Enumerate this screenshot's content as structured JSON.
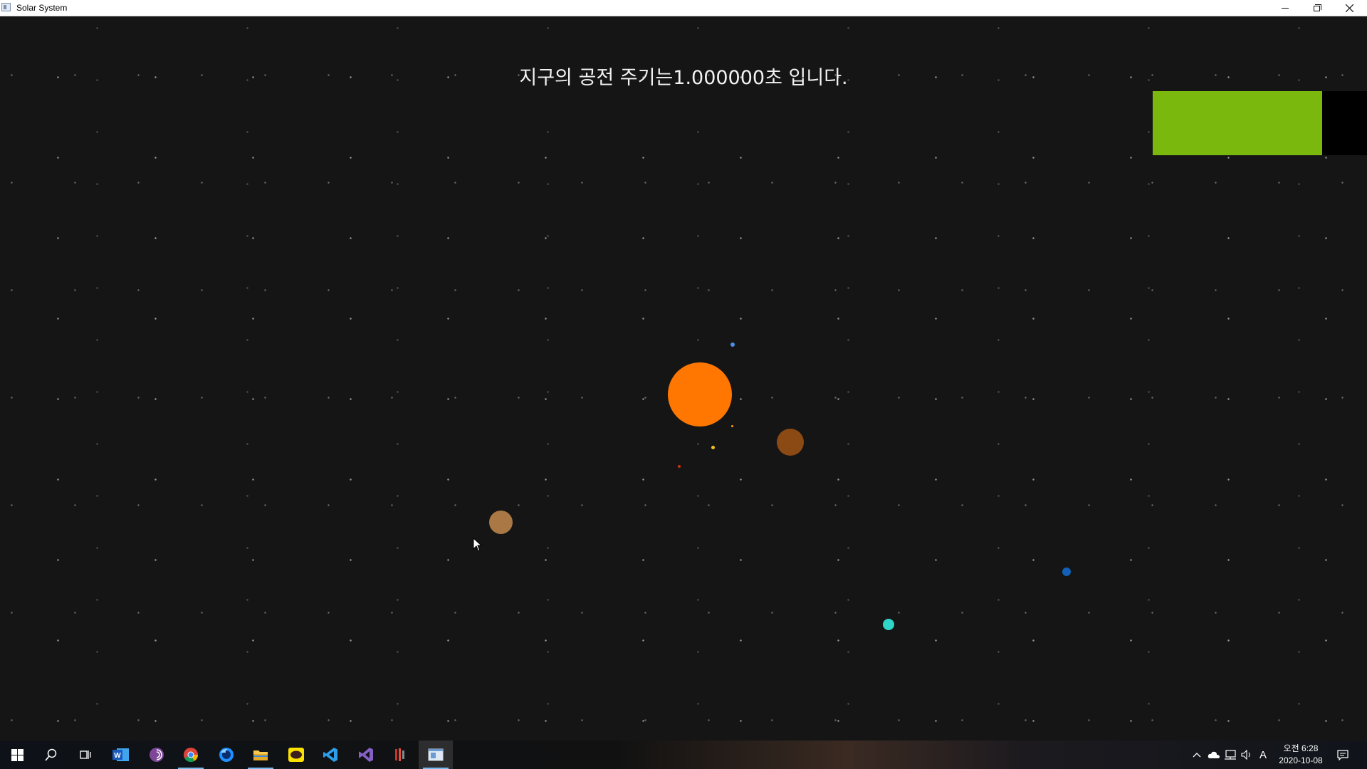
{
  "window": {
    "title": "Solar System",
    "controls": [
      "minimize-icon",
      "restore-icon",
      "close-icon"
    ]
  },
  "scene": {
    "caption": "지구의 공전 주기는1.000000초 입니다.",
    "colors": {
      "background": "#151515",
      "sun": "#ff7700",
      "green_panel": "#7ab80d",
      "black_panel": "#000000"
    },
    "bodies": [
      {
        "name": "sun",
        "color": "#ff7700"
      },
      {
        "name": "planet-brown-large",
        "color": "#8b4a14"
      },
      {
        "name": "planet-tan",
        "color": "#a97845"
      },
      {
        "name": "planet-cyan",
        "color": "#2fd6c8"
      },
      {
        "name": "planet-blue",
        "color": "#1260b8"
      },
      {
        "name": "planet-small-blue",
        "color": "#4a90e2"
      },
      {
        "name": "planet-yellow",
        "color": "#f0c020"
      },
      {
        "name": "planet-red",
        "color": "#d03010"
      },
      {
        "name": "planet-orange-tiny",
        "color": "#ff9a20"
      }
    ]
  },
  "taskbar": {
    "icons": [
      "windows-start-icon",
      "search-icon",
      "task-view-icon",
      "word-icon",
      "tor-icon",
      "chrome-icon",
      "firefox-icon",
      "file-explorer-icon",
      "kakaotalk-icon",
      "vscode-icon",
      "visual-studio-icon",
      "app-icon-red",
      "solar-system-app-icon"
    ],
    "kakao_label": "TALK",
    "tray": {
      "ime": "A",
      "ampm": "오전 6:28",
      "date": "2020-10-08"
    }
  }
}
